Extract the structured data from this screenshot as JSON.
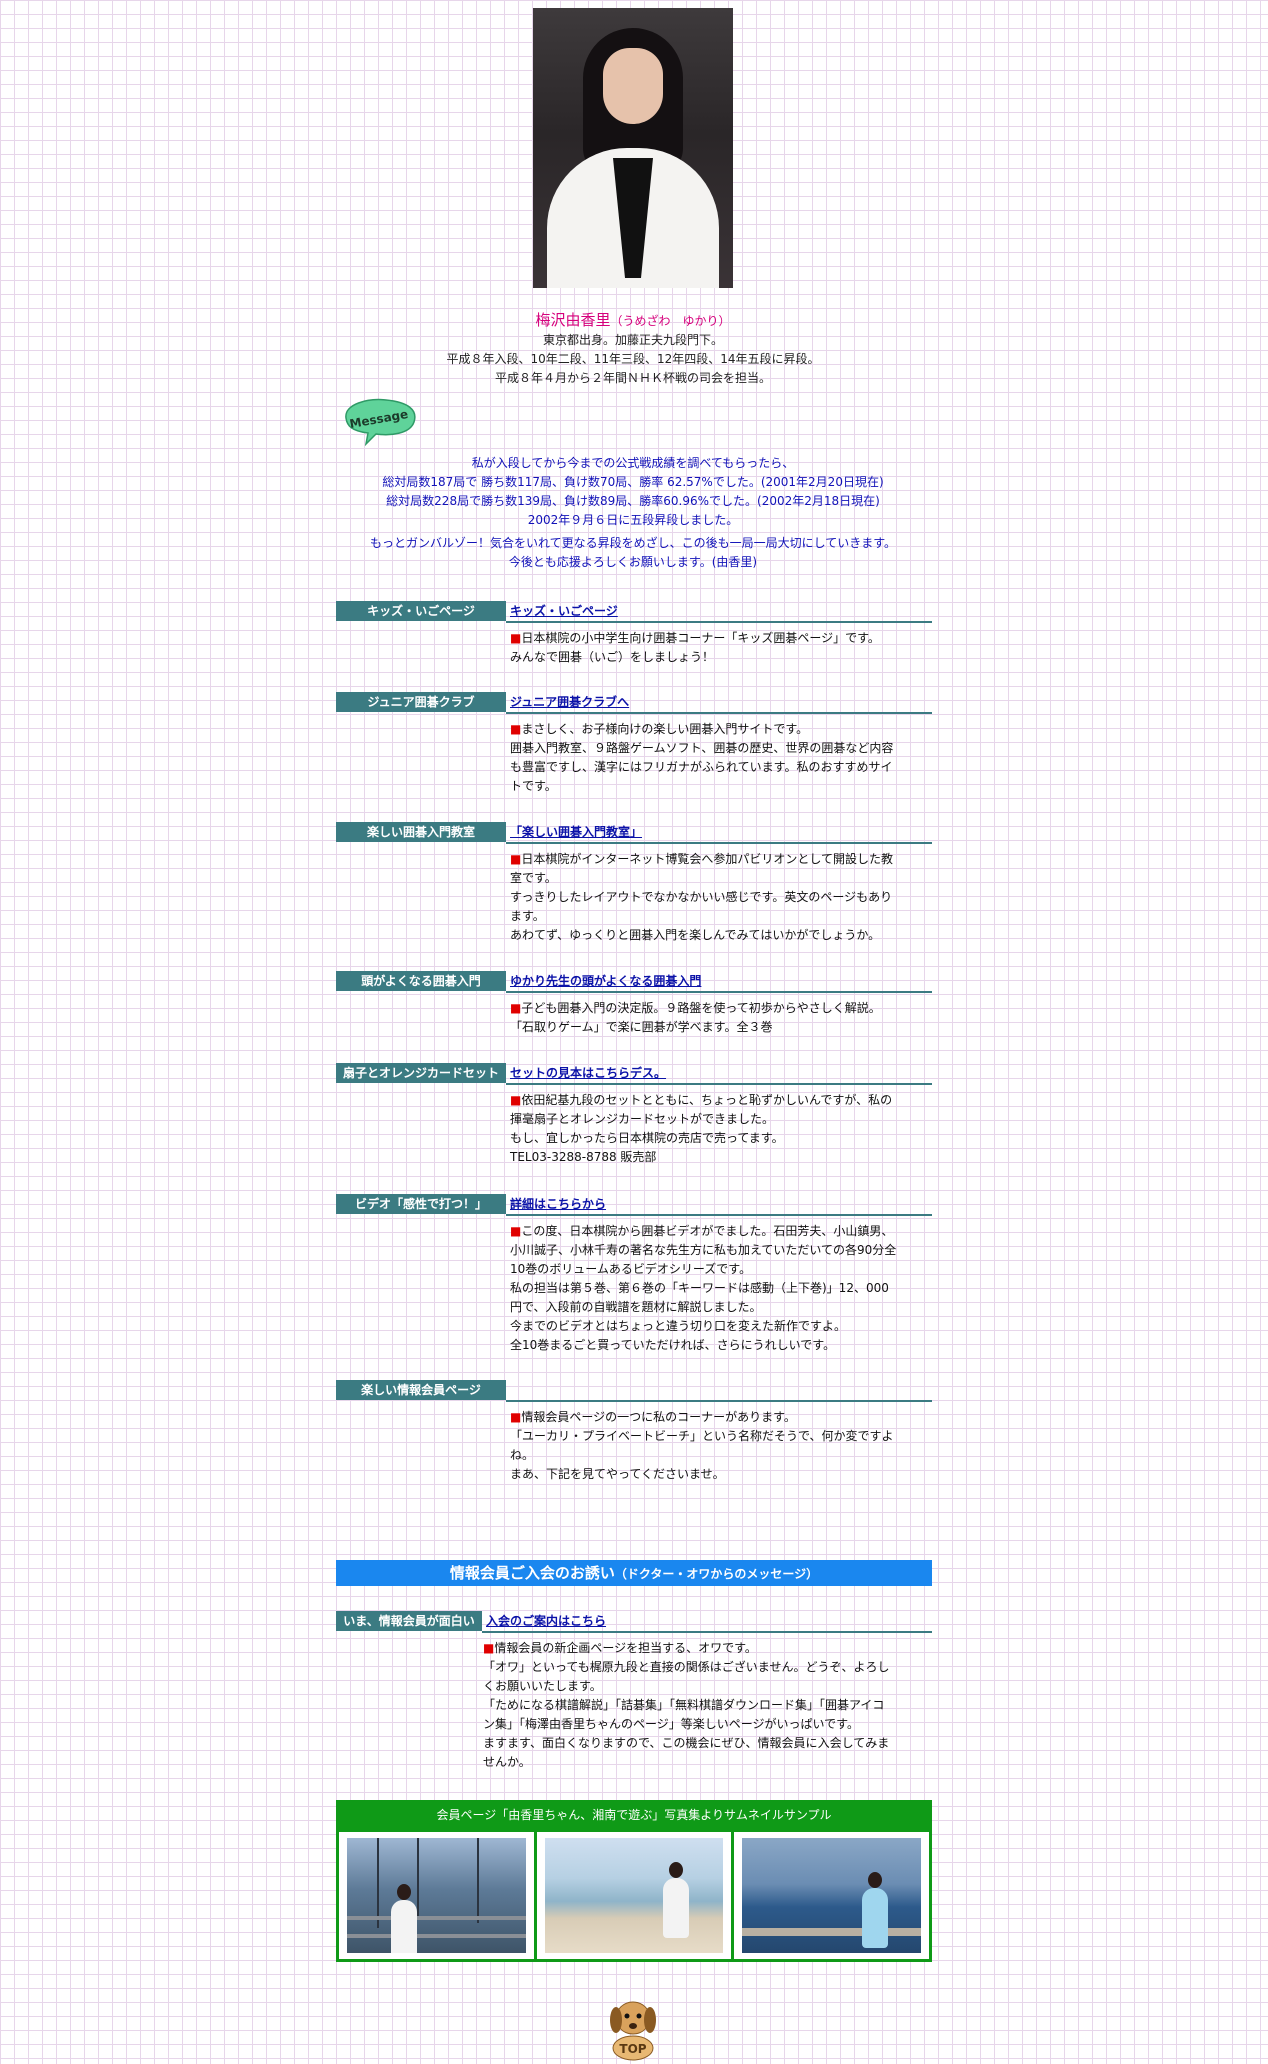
{
  "profile": {
    "name": "梅沢由香里",
    "kana": "（うめざわ　ゆかり）",
    "lines": [
      "東京都出身。加藤正夫九段門下。",
      "平成８年入段、10年二段、11年三段、12年四段、14年五段に昇段。",
      "平成８年４月から２年間ＮＨＫ杯戦の司会を担当。"
    ]
  },
  "message_bubble": {
    "label": "Message",
    "color": "#5fd39a"
  },
  "message": {
    "lines": [
      "私が入段してから今までの公式戦成績を調べてもらったら、",
      "総対局数187局で 勝ち数117局、負け数70局、勝率 62.57%でした。(2001年2月20日現在)",
      "総対局数228局で勝ち数139局、負け数89局、勝率60.96%でした。(2002年2月18日現在)",
      "2002年９月６日に五段昇段しました。"
    ],
    "lines2": [
      "もっとガンバルゾー！気合をいれて更なる昇段をめざし、この後も一局一局大切にしていきます。",
      "今後とも応援よろしくお願いします。(由香里)"
    ]
  },
  "sections": [
    {
      "label": "キッズ・いごページ",
      "link": "キッズ・いごページ",
      "bullet": "■",
      "desc": [
        "日本棋院の小中学生向け囲碁コーナー「キッズ囲碁ページ」です。",
        "みんなで囲碁（いご）をしましょう！"
      ]
    },
    {
      "label": "ジュニア囲碁クラブ",
      "link": "ジュニア囲碁クラブへ",
      "bullet": "■",
      "desc": [
        "まさしく、お子様向けの楽しい囲碁入門サイトです。",
        "囲碁入門教室、９路盤ゲームソフト、囲碁の歴史、世界の囲碁など内容",
        "も豊富ですし、漢字にはフリガナがふられています。私のおすすめサイ",
        "トです。"
      ]
    },
    {
      "label": "楽しい囲碁入門教室",
      "link": "「楽しい囲碁入門教室」",
      "bullet": "■",
      "desc": [
        "日本棋院がインターネット博覧会へ参加パビリオンとして開設した教",
        "室です。",
        "すっきりしたレイアウトでなかなかいい感じです。英文のページもあり",
        "ます。",
        "あわてず、ゆっくりと囲碁入門を楽しんでみてはいかがでしょうか。"
      ]
    },
    {
      "label": "頭がよくなる囲碁入門",
      "link": "ゆかり先生の頭がよくなる囲碁入門",
      "bullet": "■",
      "desc": [
        "子ども囲碁入門の決定版。９路盤を使って初歩からやさしく解説。",
        "「石取りゲーム」で楽に囲碁が学べます。全３巻"
      ]
    },
    {
      "label": "扇子とオレンジカードセット",
      "link": "セットの見本はこちらデス。",
      "bullet": "■",
      "desc": [
        "依田紀基九段のセットとともに、ちょっと恥ずかしいんですが、私の",
        "揮毫扇子とオレンジカードセットができました。",
        "もし、宜しかったら日本棋院の売店で売ってます。",
        "TEL03-3288-8788 販売部"
      ]
    },
    {
      "label": "ビデオ「感性で打つ！」",
      "link": "詳細はこちらから",
      "bullet": "■",
      "desc": [
        "この度、日本棋院から囲碁ビデオがでました。石田芳夫、小山鎮男、",
        "小川誠子、小林千寿の著名な先生方に私も加えていただいての各90分全",
        "10巻のボリュームあるビデオシリーズです。",
        "私の担当は第５巻、第６巻の「キーワードは感動（上下巻)」12、000",
        "円で、入段前の自戦譜を題材に解説しました。",
        "今までのビデオとはちょっと違う切り口を変えた新作ですよ。",
        "全10巻まるごと買っていただければ、さらにうれしいです。"
      ]
    },
    {
      "label": "楽しい情報会員ページ",
      "link": "",
      "bullet": "■",
      "desc": [
        "情報会員ページの一つに私のコーナーがあります。",
        "「ユーカリ・プライベートビーチ」という名称だそうで、何か変ですよ",
        "ね。",
        "まあ、下記を見てやってくださいませ。"
      ]
    }
  ],
  "banner": {
    "main": "情報会員ご入会のお誘い",
    "sub": "（ドクター・オワからのメッセージ）"
  },
  "join": {
    "label": "いま、情報会員が面白い",
    "link": "入会のご案内はこちら",
    "bullet": "■",
    "desc": [
      "情報会員の新企画ページを担当する、オワです。",
      "「オワ」といっても梶原九段と直接の関係はございません。どうぞ、よろし",
      "くお願いいたします。",
      "「ためになる棋譜解説」「詰碁集」「無料棋譜ダウンロード集」「囲碁アイコ",
      "ン集」「梅澤由香里ちゃんのページ」等楽しいページがいっぱいです。",
      "ますます、面白くなりますので、この機会にぜひ、情報会員に入会してみま",
      "せんか。"
    ]
  },
  "gallery": {
    "title": "会員ページ「由香里ちゃん、湘南で遊ぶ」写真集よりサムネイルサンプル"
  },
  "top_button": {
    "label": "TOP"
  },
  "colors": {
    "accent_teal": "#3b7b82",
    "link_blue": "#0b12a8",
    "name_pink": "#d6007c",
    "message_blue": "#1212b8",
    "banner_blue": "#1a87ef",
    "gallery_green": "#0f9a17",
    "bullet_red": "#e00000"
  }
}
